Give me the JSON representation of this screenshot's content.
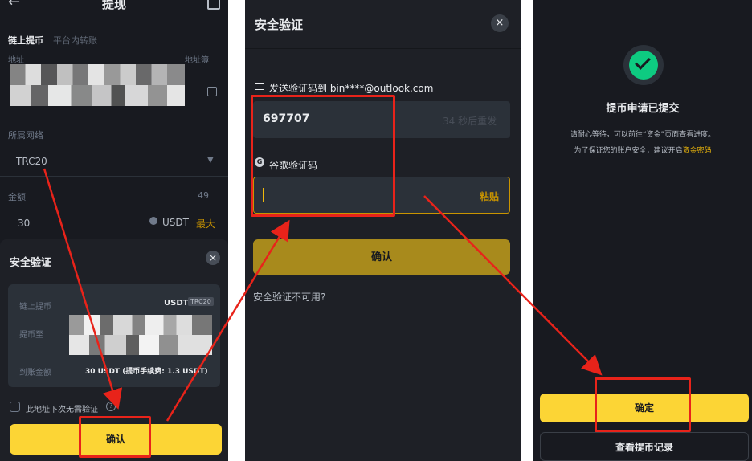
{
  "panel1": {
    "title": "提现",
    "tabs": [
      "链上提币",
      "平台内转账"
    ],
    "address_label": "地址",
    "address_book": "地址簿",
    "network_label": "所属网络",
    "network_value": "TRC20",
    "amount_label": "金额",
    "amount_available": "49",
    "amount_value": "30",
    "amount_coin": "USDT",
    "max_label": "最大",
    "sheet": {
      "title": "安全验证",
      "row1_label": "链上提币",
      "row1_value": "USDT",
      "row1_badge": "TRC20",
      "row2_label": "提币至",
      "row3_label": "到账金额",
      "row3_value": "30 USDT (提币手续费: 1.3 USDT)",
      "checkbox_label": "此地址下次无需验证",
      "help_icon": "?",
      "confirm_label": "确认"
    }
  },
  "panel2": {
    "title": "安全验证",
    "send_label": "发送验证码到 bin****@outlook.com",
    "code_value": "697707",
    "resend_label": "34 秒后重发",
    "g_icon": "G",
    "google_label": "谷歌验证码",
    "paste_label": "粘贴",
    "confirm_label": "确认",
    "unavailable_label": "安全验证不可用?"
  },
  "panel3": {
    "title": "提币申请已提交",
    "desc_line1": "请耐心等待，可以前往“资金”页面查看进度。",
    "desc_line2": "为了保证您的账户安全，建议开启",
    "desc_link": "资金密码",
    "ok_label": "确定",
    "record_label": "查看提币记录"
  },
  "colors": {
    "accent": "#fcd535",
    "annotation": "#e8231a",
    "success": "#0ecb81"
  }
}
